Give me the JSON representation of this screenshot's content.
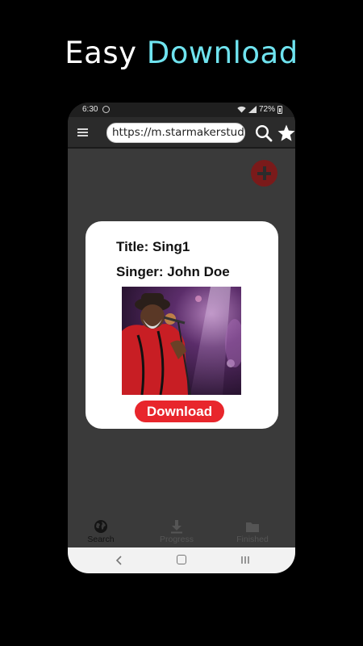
{
  "headline": {
    "word1": "Easy",
    "word2": "Download"
  },
  "status_bar": {
    "time": "6:30",
    "battery": "72%"
  },
  "browser": {
    "url": "https://m.starmakerstudios.com"
  },
  "song_dialog": {
    "title": "Title: Sing1",
    "singer": "Singer: John Doe",
    "download_label": "Download"
  },
  "bottom_nav": {
    "items": [
      {
        "label": "Search",
        "icon": "globe-icon",
        "active": true
      },
      {
        "label": "Progress",
        "icon": "download-arrow-icon",
        "active": false
      },
      {
        "label": "Finished",
        "icon": "folder-icon",
        "active": false
      }
    ]
  },
  "colors": {
    "accent_text": "#6fe3ef",
    "download_button": "#e8262c",
    "add_fab": "#7a1a1a"
  }
}
